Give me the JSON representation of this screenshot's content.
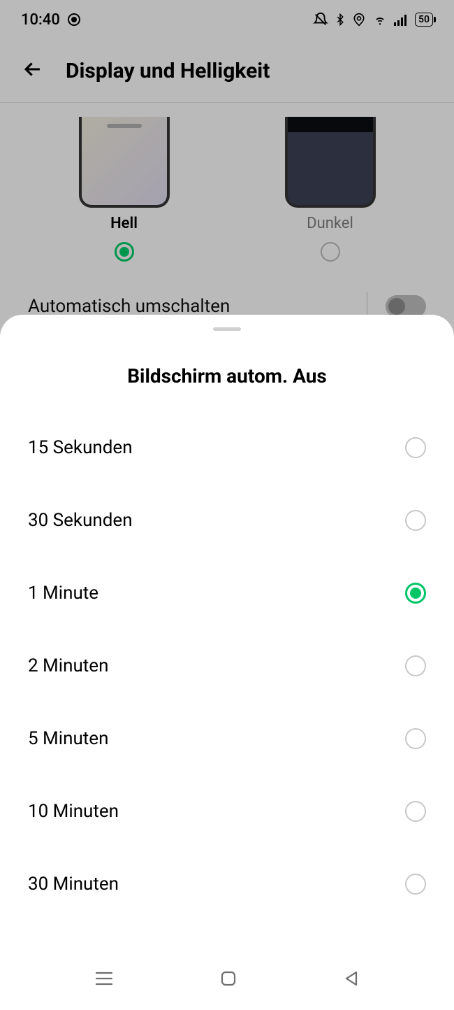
{
  "status_bar": {
    "time": "10:40",
    "battery": "50"
  },
  "header": {
    "title": "Display und Helligkeit"
  },
  "themes": {
    "light_label": "Hell",
    "dark_label": "Dunkel"
  },
  "auto_switch_label": "Automatisch umschalten",
  "sheet": {
    "title": "Bildschirm autom. Aus",
    "options": [
      {
        "label": "15 Sekunden",
        "selected": false
      },
      {
        "label": "30 Sekunden",
        "selected": false
      },
      {
        "label": "1 Minute",
        "selected": true
      },
      {
        "label": "2 Minuten",
        "selected": false
      },
      {
        "label": "5 Minuten",
        "selected": false
      },
      {
        "label": "10 Minuten",
        "selected": false
      },
      {
        "label": "30 Minuten",
        "selected": false
      }
    ]
  }
}
